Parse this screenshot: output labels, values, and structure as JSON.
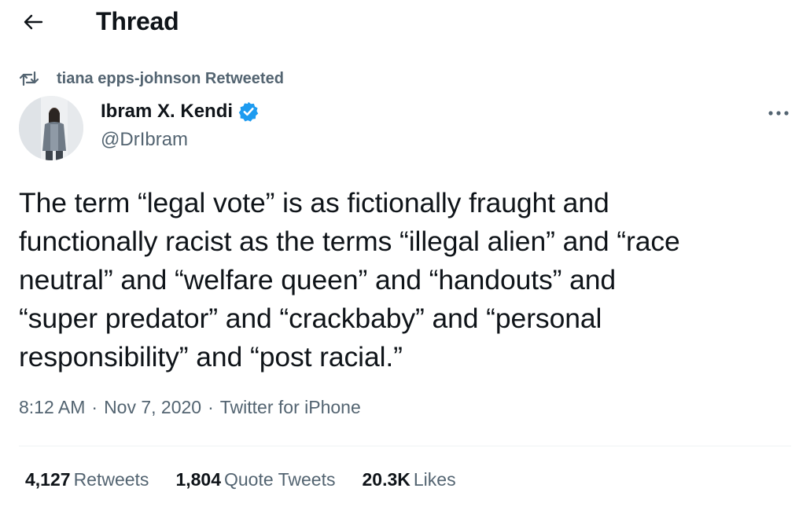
{
  "header": {
    "title": "Thread"
  },
  "retweet": {
    "label": "tiana epps-johnson Retweeted"
  },
  "author": {
    "name": "Ibram X. Kendi",
    "handle": "@DrIbram",
    "verified": true
  },
  "tweet": {
    "text": "The term “legal vote” is as fictionally fraught and\nfunctionally racist as the terms “illegal alien” and “race\nneutral” and “welfare queen” and “handouts” and\n“super predator” and “crackbaby” and “personal\nresponsibility” and “post racial.”",
    "time": "8:12 AM",
    "date": "Nov 7, 2020",
    "source": "Twitter for iPhone",
    "separator": "·"
  },
  "stats": [
    {
      "count": "4,127",
      "label": "Retweets"
    },
    {
      "count": "1,804",
      "label": "Quote Tweets"
    },
    {
      "count": "20.3K",
      "label": "Likes"
    }
  ],
  "icons": {
    "back": "arrow-left-icon",
    "retweet": "retweet-icon",
    "verified": "verified-badge-icon",
    "more": "more-options-icon"
  },
  "colors": {
    "text": "#0f1419",
    "secondary": "#536471",
    "verified": "#1d9bf0",
    "divider": "#eff3f4"
  }
}
